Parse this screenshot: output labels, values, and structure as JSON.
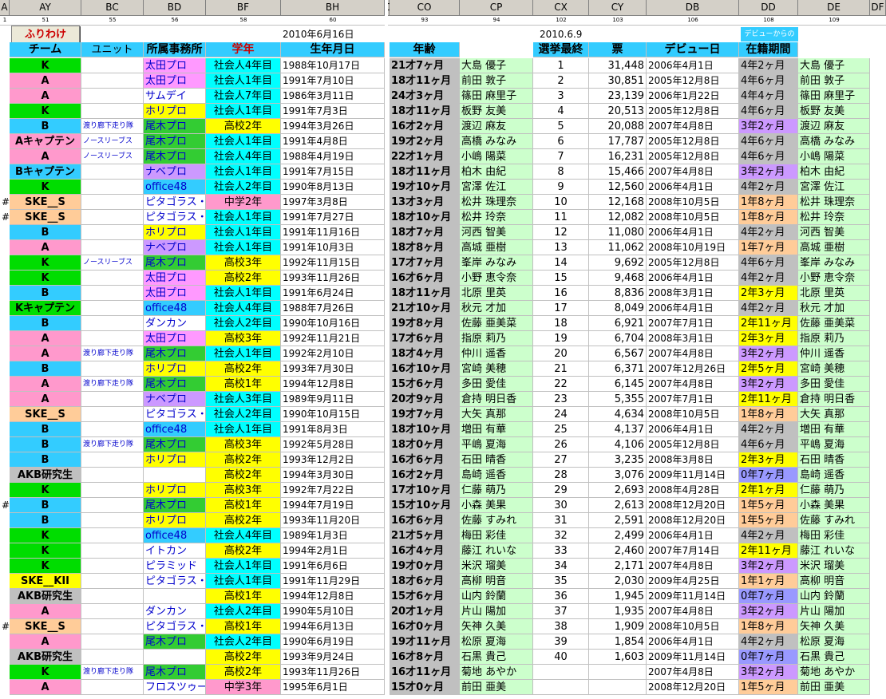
{
  "columns": [
    "A",
    "AY",
    "BC",
    "BD",
    "BF",
    "BH",
    "C",
    "CO",
    "CP",
    "CX",
    "CY",
    "DB",
    "DD",
    "DE",
    "DF"
  ],
  "colnums": [
    "1",
    "51",
    "55",
    "56",
    "58",
    "60",
    "",
    "93",
    "94",
    "102",
    "103",
    "106",
    "108",
    "109",
    ""
  ],
  "top": {
    "button": "ふりわけ",
    "date1": "2010年6月16日",
    "date2": "2010.6.9",
    "debut_since": "デビューからの"
  },
  "headers": {
    "team": "チーム",
    "unit": "ユニット",
    "office": "所属事務所",
    "grade": "学年",
    "birth": "生年月日",
    "age": "年齢",
    "rank": "選挙最終",
    "votes": "票",
    "debut": "デビュー日",
    "period": "在籍期間"
  },
  "colors": {
    "K": "#00dd00",
    "A": "#ff99cc",
    "B": "#33ccff",
    "SKE": "#ffcc99",
    "KEN": "#c0c0c0",
    "ohta": "#ff99ff",
    "sam": "#ffffff",
    "hori": "#ffff00",
    "ogi": "#33cc33",
    "nabe": "#cc99ff",
    "off": "#33ccff",
    "pita": "#ffffff",
    "dan": "#ffffff",
    "ito": "#ffffff",
    "pyr": "#ffffff",
    "fro": "#ffffff",
    "sha": "#00ffff",
    "kou": "#ffff00",
    "chu": "#ff99cc",
    "age": "#c0c0c0",
    "name": "#ccffcc",
    "p4": "#c0c0c0",
    "p3": "#cc99ff",
    "p2": "#ffff00",
    "p1": "#ffcc99",
    "p0": "#9999ff"
  },
  "rows": [
    {
      "mark": "",
      "team": "K",
      "tc": "K",
      "unit": "",
      "office": "太田プロ",
      "oc": "ohta",
      "grade": "社会人4年目",
      "gc": "sha",
      "birth": "1988年10月17日",
      "age": "21才7ヶ月",
      "name": "大島 優子",
      "rank": "1",
      "votes": "31,448",
      "debut": "2006年4月1日",
      "period": "4年2ヶ月",
      "pc": "p4",
      "name2": "大島 優子"
    },
    {
      "mark": "",
      "team": "A",
      "tc": "A",
      "unit": "",
      "office": "太田プロ",
      "oc": "ohta",
      "grade": "社会人1年目",
      "gc": "sha",
      "birth": "1991年7月10日",
      "age": "18才11ヶ月",
      "name": "前田 敦子",
      "rank": "2",
      "votes": "30,851",
      "debut": "2005年12月8日",
      "period": "4年6ヶ月",
      "pc": "p4",
      "name2": "前田 敦子"
    },
    {
      "mark": "",
      "team": "A",
      "tc": "A",
      "unit": "",
      "office": "サムデイ",
      "oc": "sam",
      "grade": "社会人7年目",
      "gc": "sha",
      "birth": "1986年3月11日",
      "age": "24才3ヶ月",
      "name": "篠田 麻里子",
      "rank": "3",
      "votes": "23,139",
      "debut": "2006年1月22日",
      "period": "4年4ヶ月",
      "pc": "p4",
      "name2": "篠田 麻里子"
    },
    {
      "mark": "",
      "team": "K",
      "tc": "K",
      "unit": "",
      "office": "ホリプロ",
      "oc": "hori",
      "grade": "社会人1年目",
      "gc": "sha",
      "birth": "1991年7月3日",
      "age": "18才11ヶ月",
      "name": "板野 友美",
      "rank": "4",
      "votes": "20,513",
      "debut": "2005年12月8日",
      "period": "4年6ヶ月",
      "pc": "p4",
      "name2": "板野 友美"
    },
    {
      "mark": "",
      "team": "B",
      "tc": "B",
      "unit": "渡り廊下走り隊",
      "office": "尾木プロ",
      "oc": "ogi",
      "grade": "高校2年",
      "gc": "kou",
      "birth": "1994年3月26日",
      "age": "16才2ヶ月",
      "name": "渡辺 麻友",
      "rank": "5",
      "votes": "20,088",
      "debut": "2007年4月8日",
      "period": "3年2ヶ月",
      "pc": "p3",
      "name2": "渡辺 麻友"
    },
    {
      "mark": "",
      "team": "Aキャプテン",
      "tc": "A",
      "unit": "ノースリーブス",
      "office": "尾木プロ",
      "oc": "ogi",
      "grade": "社会人1年目",
      "gc": "sha",
      "birth": "1991年4月8日",
      "age": "19才2ヶ月",
      "name": "高橋 みなみ",
      "rank": "6",
      "votes": "17,787",
      "debut": "2005年12月8日",
      "period": "4年6ヶ月",
      "pc": "p4",
      "name2": "高橋 みなみ"
    },
    {
      "mark": "",
      "team": "A",
      "tc": "A",
      "unit": "ノースリーブス",
      "office": "尾木プロ",
      "oc": "ogi",
      "grade": "社会人4年目",
      "gc": "sha",
      "birth": "1988年4月19日",
      "age": "22才1ヶ月",
      "name": "小嶋 陽菜",
      "rank": "7",
      "votes": "16,231",
      "debut": "2005年12月8日",
      "period": "4年6ヶ月",
      "pc": "p4",
      "name2": "小嶋 陽菜"
    },
    {
      "mark": "",
      "team": "Bキャプテン",
      "tc": "B",
      "unit": "",
      "office": "ナベプロ",
      "oc": "nabe",
      "grade": "社会人1年目",
      "gc": "sha",
      "birth": "1991年7月15日",
      "age": "18才11ヶ月",
      "name": "柏木 由紀",
      "rank": "8",
      "votes": "15,466",
      "debut": "2007年4月8日",
      "period": "3年2ヶ月",
      "pc": "p3",
      "name2": "柏木 由紀"
    },
    {
      "mark": "",
      "team": "K",
      "tc": "K",
      "unit": "",
      "office": "office48",
      "oc": "off",
      "grade": "社会人2年目",
      "gc": "sha",
      "birth": "1990年8月13日",
      "age": "19才10ヶ月",
      "name": "宮澤 佐江",
      "rank": "9",
      "votes": "12,560",
      "debut": "2006年4月1日",
      "period": "4年2ヶ月",
      "pc": "p4",
      "name2": "宮澤 佐江"
    },
    {
      "mark": "#",
      "team": "SKE__S",
      "tc": "SKE",
      "unit": "",
      "office": "ピタゴラス・",
      "oc": "pita",
      "grade": "中学2年",
      "gc": "chu",
      "birth": "1997年3月8日",
      "age": "13才3ヶ月",
      "name": "松井 珠理奈",
      "rank": "10",
      "votes": "12,168",
      "debut": "2008年10月5日",
      "period": "1年8ヶ月",
      "pc": "p1",
      "name2": "松井 珠理奈"
    },
    {
      "mark": "#",
      "team": "SKE__S",
      "tc": "SKE",
      "unit": "",
      "office": "ピタゴラス・",
      "oc": "pita",
      "grade": "社会人1年目",
      "gc": "sha",
      "birth": "1991年7月27日",
      "age": "18才10ヶ月",
      "name": "松井 玲奈",
      "rank": "11",
      "votes": "12,082",
      "debut": "2008年10月5日",
      "period": "1年8ヶ月",
      "pc": "p1",
      "name2": "松井 玲奈"
    },
    {
      "mark": "",
      "team": "B",
      "tc": "B",
      "unit": "",
      "office": "ホリプロ",
      "oc": "hori",
      "grade": "社会人1年目",
      "gc": "sha",
      "birth": "1991年11月16日",
      "age": "18才7ヶ月",
      "name": "河西 智美",
      "rank": "12",
      "votes": "11,080",
      "debut": "2006年4月1日",
      "period": "4年2ヶ月",
      "pc": "p4",
      "name2": "河西 智美"
    },
    {
      "mark": "",
      "team": "A",
      "tc": "A",
      "unit": "",
      "office": "ナベプロ",
      "oc": "nabe",
      "grade": "社会人1年目",
      "gc": "sha",
      "birth": "1991年10月3日",
      "age": "18才8ヶ月",
      "name": "高城 亜樹",
      "rank": "13",
      "votes": "11,062",
      "debut": "2008年10月19日",
      "period": "1年7ヶ月",
      "pc": "p1",
      "name2": "高城 亜樹"
    },
    {
      "mark": "",
      "team": "K",
      "tc": "K",
      "unit": "ノースリーブス",
      "office": "尾木プロ",
      "oc": "ogi",
      "grade": "高校3年",
      "gc": "kou",
      "birth": "1992年11月15日",
      "age": "17才7ヶ月",
      "name": "峯岸 みなみ",
      "rank": "14",
      "votes": "9,692",
      "debut": "2005年12月8日",
      "period": "4年6ヶ月",
      "pc": "p4",
      "name2": "峯岸 みなみ"
    },
    {
      "mark": "",
      "team": "K",
      "tc": "K",
      "unit": "",
      "office": "太田プロ",
      "oc": "ohta",
      "grade": "高校2年",
      "gc": "kou",
      "birth": "1993年11月26日",
      "age": "16才6ヶ月",
      "name": "小野 恵令奈",
      "rank": "15",
      "votes": "9,468",
      "debut": "2006年4月1日",
      "period": "4年2ヶ月",
      "pc": "p4",
      "name2": "小野 恵令奈"
    },
    {
      "mark": "",
      "team": "B",
      "tc": "B",
      "unit": "",
      "office": "太田プロ",
      "oc": "ohta",
      "grade": "社会人1年目",
      "gc": "sha",
      "birth": "1991年6月24日",
      "age": "18才11ヶ月",
      "name": "北原 里英",
      "rank": "16",
      "votes": "8,836",
      "debut": "2008年3月1日",
      "period": "2年3ヶ月",
      "pc": "p2",
      "name2": "北原 里英"
    },
    {
      "mark": "",
      "team": "Kキャプテン",
      "tc": "K",
      "unit": "",
      "office": "office48",
      "oc": "off",
      "grade": "社会人4年目",
      "gc": "sha",
      "birth": "1988年7月26日",
      "age": "21才10ヶ月",
      "name": "秋元 才加",
      "rank": "17",
      "votes": "8,049",
      "debut": "2006年4月1日",
      "period": "4年2ヶ月",
      "pc": "p4",
      "name2": "秋元 才加"
    },
    {
      "mark": "",
      "team": "B",
      "tc": "B",
      "unit": "",
      "office": "ダンカン",
      "oc": "dan",
      "grade": "社会人2年目",
      "gc": "sha",
      "birth": "1990年10月16日",
      "age": "19才8ヶ月",
      "name": "佐藤 亜美菜",
      "rank": "18",
      "votes": "6,921",
      "debut": "2007年7月1日",
      "period": "2年11ヶ月",
      "pc": "p2",
      "name2": "佐藤 亜美菜"
    },
    {
      "mark": "",
      "team": "A",
      "tc": "A",
      "unit": "",
      "office": "太田プロ",
      "oc": "ohta",
      "grade": "高校3年",
      "gc": "kou",
      "birth": "1992年11月21日",
      "age": "17才6ヶ月",
      "name": "指原 莉乃",
      "rank": "19",
      "votes": "6,704",
      "debut": "2008年3月1日",
      "period": "2年3ヶ月",
      "pc": "p2",
      "name2": "指原 莉乃"
    },
    {
      "mark": "",
      "team": "A",
      "tc": "A",
      "unit": "渡り廊下走り隊",
      "office": "尾木プロ",
      "oc": "ogi",
      "grade": "社会人1年目",
      "gc": "sha",
      "birth": "1992年2月10日",
      "age": "18才4ヶ月",
      "name": "仲川 遥香",
      "rank": "20",
      "votes": "6,567",
      "debut": "2007年4月8日",
      "period": "3年2ヶ月",
      "pc": "p3",
      "name2": "仲川 遥香"
    },
    {
      "mark": "",
      "team": "B",
      "tc": "B",
      "unit": "",
      "office": "ホリプロ",
      "oc": "hori",
      "grade": "高校2年",
      "gc": "kou",
      "birth": "1993年7月30日",
      "age": "16才10ヶ月",
      "name": "宮崎 美穂",
      "rank": "21",
      "votes": "6,371",
      "debut": "2007年12月26日",
      "period": "2年5ヶ月",
      "pc": "p2",
      "name2": "宮崎 美穂"
    },
    {
      "mark": "",
      "team": "A",
      "tc": "A",
      "unit": "渡り廊下走り隊",
      "office": "尾木プロ",
      "oc": "ogi",
      "grade": "高校1年",
      "gc": "kou",
      "birth": "1994年12月8日",
      "age": "15才6ヶ月",
      "name": "多田 愛佳",
      "rank": "22",
      "votes": "6,145",
      "debut": "2007年4月8日",
      "period": "3年2ヶ月",
      "pc": "p3",
      "name2": "多田 愛佳"
    },
    {
      "mark": "",
      "team": "A",
      "tc": "A",
      "unit": "",
      "office": "ナベプロ",
      "oc": "nabe",
      "grade": "社会人3年目",
      "gc": "sha",
      "birth": "1989年9月11日",
      "age": "20才9ヶ月",
      "name": "倉持 明日香",
      "rank": "23",
      "votes": "5,355",
      "debut": "2007年7月1日",
      "period": "2年11ヶ月",
      "pc": "p2",
      "name2": "倉持 明日香"
    },
    {
      "mark": "",
      "team": "SKE__S",
      "tc": "SKE",
      "unit": "",
      "office": "ピタゴラス・",
      "oc": "pita",
      "grade": "社会人2年目",
      "gc": "sha",
      "birth": "1990年10月15日",
      "age": "19才7ヶ月",
      "name": "大矢 真那",
      "rank": "24",
      "votes": "4,634",
      "debut": "2008年10月5日",
      "period": "1年8ヶ月",
      "pc": "p1",
      "name2": "大矢 真那"
    },
    {
      "mark": "",
      "team": "B",
      "tc": "B",
      "unit": "",
      "office": "office48",
      "oc": "off",
      "grade": "社会人1年目",
      "gc": "sha",
      "birth": "1991年8月3日",
      "age": "18才10ヶ月",
      "name": "増田 有華",
      "rank": "25",
      "votes": "4,137",
      "debut": "2006年4月1日",
      "period": "4年2ヶ月",
      "pc": "p4",
      "name2": "増田 有華"
    },
    {
      "mark": "",
      "team": "B",
      "tc": "B",
      "unit": "渡り廊下走り隊",
      "office": "尾木プロ",
      "oc": "ogi",
      "grade": "高校3年",
      "gc": "kou",
      "birth": "1992年5月28日",
      "age": "18才0ヶ月",
      "name": "平嶋 夏海",
      "rank": "26",
      "votes": "4,106",
      "debut": "2005年12月8日",
      "period": "4年6ヶ月",
      "pc": "p4",
      "name2": "平嶋 夏海"
    },
    {
      "mark": "",
      "team": "B",
      "tc": "B",
      "unit": "",
      "office": "ホリプロ",
      "oc": "hori",
      "grade": "高校2年",
      "gc": "kou",
      "birth": "1993年12月2日",
      "age": "16才6ヶ月",
      "name": "石田 晴香",
      "rank": "27",
      "votes": "3,235",
      "debut": "2008年3月8日",
      "period": "2年3ヶ月",
      "pc": "p2",
      "name2": "石田 晴香"
    },
    {
      "mark": "",
      "team": "AKB研究生",
      "tc": "KEN",
      "unit": "",
      "office": "",
      "oc": "sam",
      "grade": "高校2年",
      "gc": "kou",
      "birth": "1994年3月30日",
      "age": "16才2ヶ月",
      "name": "島崎 遥香",
      "rank": "28",
      "votes": "3,076",
      "debut": "2009年11月14日",
      "period": "0年7ヶ月",
      "pc": "p0",
      "name2": "島崎 遥香"
    },
    {
      "mark": "",
      "team": "K",
      "tc": "K",
      "unit": "",
      "office": "ホリプロ",
      "oc": "hori",
      "grade": "高校3年",
      "gc": "kou",
      "birth": "1992年7月22日",
      "age": "17才10ヶ月",
      "name": "仁藤 萌乃",
      "rank": "29",
      "votes": "2,693",
      "debut": "2008年4月28日",
      "period": "2年1ヶ月",
      "pc": "p2",
      "name2": "仁藤 萌乃"
    },
    {
      "mark": "#",
      "team": "B",
      "tc": "B",
      "unit": "",
      "office": "尾木プロ",
      "oc": "ogi",
      "grade": "高校1年",
      "gc": "kou",
      "birth": "1994年7月19日",
      "age": "15才10ヶ月",
      "name": "小森 美果",
      "rank": "30",
      "votes": "2,613",
      "debut": "2008年12月20日",
      "period": "1年5ヶ月",
      "pc": "p1",
      "name2": "小森 美果"
    },
    {
      "mark": "",
      "team": "B",
      "tc": "B",
      "unit": "",
      "office": "ホリプロ",
      "oc": "hori",
      "grade": "高校2年",
      "gc": "kou",
      "birth": "1993年11月20日",
      "age": "16才6ヶ月",
      "name": "佐藤 すみれ",
      "rank": "31",
      "votes": "2,591",
      "debut": "2008年12月20日",
      "period": "1年5ヶ月",
      "pc": "p1",
      "name2": "佐藤 すみれ"
    },
    {
      "mark": "",
      "team": "K",
      "tc": "K",
      "unit": "",
      "office": "office48",
      "oc": "off",
      "grade": "社会人4年目",
      "gc": "sha",
      "birth": "1989年1月3日",
      "age": "21才5ヶ月",
      "name": "梅田 彩佳",
      "rank": "32",
      "votes": "2,499",
      "debut": "2006年4月1日",
      "period": "4年2ヶ月",
      "pc": "p4",
      "name2": "梅田 彩佳"
    },
    {
      "mark": "",
      "team": "K",
      "tc": "K",
      "unit": "",
      "office": "イトカン",
      "oc": "ito",
      "grade": "高校2年",
      "gc": "kou",
      "birth": "1994年2月1日",
      "age": "16才4ヶ月",
      "name": "藤江 れいな",
      "rank": "33",
      "votes": "2,460",
      "debut": "2007年7月14日",
      "period": "2年11ヶ月",
      "pc": "p2",
      "name2": "藤江 れいな"
    },
    {
      "mark": "",
      "team": "K",
      "tc": "K",
      "unit": "",
      "office": "ピラミッド",
      "oc": "pyr",
      "grade": "社会人1年目",
      "gc": "sha",
      "birth": "1991年6月6日",
      "age": "19才0ヶ月",
      "name": "米沢 瑠美",
      "rank": "34",
      "votes": "2,171",
      "debut": "2007年4月8日",
      "period": "3年2ヶ月",
      "pc": "p3",
      "name2": "米沢 瑠美"
    },
    {
      "mark": "",
      "team": "SKE__KII",
      "tc": "hori",
      "unit": "",
      "office": "ピタゴラス・",
      "oc": "pita",
      "grade": "社会人1年目",
      "gc": "sha",
      "birth": "1991年11月29日",
      "age": "18才6ヶ月",
      "name": "高柳 明音",
      "rank": "35",
      "votes": "2,030",
      "debut": "2009年4月25日",
      "period": "1年1ヶ月",
      "pc": "p1",
      "name2": "高柳 明音"
    },
    {
      "mark": "",
      "team": "AKB研究生",
      "tc": "KEN",
      "unit": "",
      "office": "",
      "oc": "sam",
      "grade": "高校1年",
      "gc": "kou",
      "birth": "1994年12月8日",
      "age": "15才6ヶ月",
      "name": "山内 鈴蘭",
      "rank": "36",
      "votes": "1,945",
      "debut": "2009年11月14日",
      "period": "0年7ヶ月",
      "pc": "p0",
      "name2": "山内 鈴蘭"
    },
    {
      "mark": "",
      "team": "A",
      "tc": "A",
      "unit": "",
      "office": "ダンカン",
      "oc": "dan",
      "grade": "社会人2年目",
      "gc": "sha",
      "birth": "1990年5月10日",
      "age": "20才1ヶ月",
      "name": "片山 陽加",
      "rank": "37",
      "votes": "1,935",
      "debut": "2007年4月8日",
      "period": "3年2ヶ月",
      "pc": "p3",
      "name2": "片山 陽加"
    },
    {
      "mark": "#",
      "team": "SKE__S",
      "tc": "SKE",
      "unit": "",
      "office": "ピタゴラス・",
      "oc": "pita",
      "grade": "高校1年",
      "gc": "kou",
      "birth": "1994年6月13日",
      "age": "16才0ヶ月",
      "name": "矢神 久美",
      "rank": "38",
      "votes": "1,909",
      "debut": "2008年10月5日",
      "period": "1年8ヶ月",
      "pc": "p1",
      "name2": "矢神 久美"
    },
    {
      "mark": "",
      "team": "A",
      "tc": "A",
      "unit": "",
      "office": "尾木プロ",
      "oc": "ogi",
      "grade": "社会人2年目",
      "gc": "sha",
      "birth": "1990年6月19日",
      "age": "19才11ヶ月",
      "name": "松原 夏海",
      "rank": "39",
      "votes": "1,854",
      "debut": "2006年4月1日",
      "period": "4年2ヶ月",
      "pc": "p4",
      "name2": "松原 夏海"
    },
    {
      "mark": "",
      "team": "AKB研究生",
      "tc": "KEN",
      "unit": "",
      "office": "",
      "oc": "sam",
      "grade": "高校2年",
      "gc": "kou",
      "birth": "1993年9月24日",
      "age": "16才8ヶ月",
      "name": "石黒 貴己",
      "rank": "40",
      "votes": "1,603",
      "debut": "2009年11月14日",
      "period": "0年7ヶ月",
      "pc": "p0",
      "name2": "石黒 貴己"
    },
    {
      "mark": "",
      "team": "K",
      "tc": "K",
      "unit": "渡り廊下走り隊",
      "office": "尾木プロ",
      "oc": "ogi",
      "grade": "高校2年",
      "gc": "kou",
      "birth": "1993年11月26日",
      "age": "16才11ヶ月",
      "name": "菊地 あやか",
      "rank": "",
      "votes": "",
      "debut": "2007年4月8日",
      "period": "3年2ヶ月",
      "pc": "p3",
      "name2": "菊地 あやか"
    },
    {
      "mark": "",
      "team": "A",
      "tc": "A",
      "unit": "",
      "office": "フロスツゥー",
      "oc": "fro",
      "grade": "中学3年",
      "gc": "chu",
      "birth": "1995年6月1日",
      "age": "15才0ヶ月",
      "name": "前田 亜美",
      "rank": "",
      "votes": "",
      "debut": "2008年12月20日",
      "period": "1年5ヶ月",
      "pc": "p1",
      "name2": "前田 亜美"
    }
  ]
}
